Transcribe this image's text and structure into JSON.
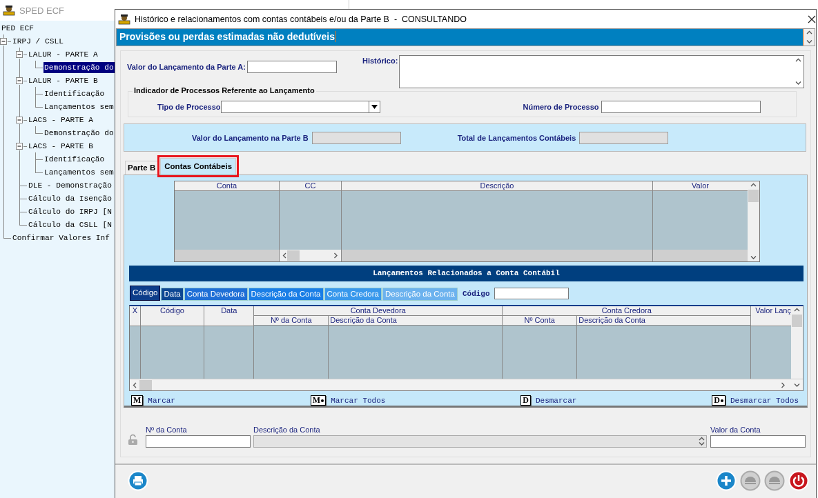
{
  "background_windows": [
    {
      "title": "SPED ECF"
    }
  ],
  "tree": {
    "root": "PED ECF",
    "items": [
      {
        "label": "IRPJ / CSLL",
        "selected": false,
        "expanded": true,
        "children": [
          {
            "label": "LALUR - PARTE A",
            "selected": false,
            "expanded": true,
            "children": [
              {
                "label": "Demonstração do",
                "selected": true
              }
            ]
          },
          {
            "label": "LALUR - PARTE B",
            "selected": false,
            "expanded": true,
            "children": [
              {
                "label": "Identificação",
                "selected": false
              },
              {
                "label": "Lançamentos sem",
                "selected": false
              }
            ]
          },
          {
            "label": "LACS - PARTE A",
            "selected": false,
            "expanded": true,
            "children": [
              {
                "label": "Demonstração do",
                "selected": false
              }
            ]
          },
          {
            "label": "LACS - PARTE B",
            "selected": false,
            "expanded": true,
            "children": [
              {
                "label": "Identificação",
                "selected": false
              },
              {
                "label": "Lançamentos sem",
                "selected": false
              }
            ]
          },
          {
            "label": "DLE - Demonstração",
            "selected": false
          },
          {
            "label": "Cálculo da Isenção",
            "selected": false
          },
          {
            "label": "Cálculo do IRPJ [N",
            "selected": false
          },
          {
            "label": "Cálculo da CSLL [N",
            "selected": false
          }
        ]
      },
      {
        "label": "Confirmar Valores Inf",
        "selected": false
      }
    ]
  },
  "dialog": {
    "title": "Histórico e relacionamentos com contas contábeis e/ou da Parte B  -  CONSULTANDO",
    "header": "Provisões ou perdas estimadas não dedutíveis",
    "valor_parte_a": {
      "label": "Valor do Lançamento da Parte A:"
    },
    "historico": {
      "label": "Histórico:"
    },
    "processos": {
      "legend": "Indicador de Processos Referente ao Lançamento",
      "tipo_label": "Tipo de Processo",
      "numero_label": "Número de Processo"
    },
    "valor_parte_b": {
      "label": "Valor do Lançamento na Parte B",
      "disabled": true
    },
    "total_lancamentos": {
      "label": "Total de Lançamentos Contábeis",
      "disabled": true
    },
    "tabs": [
      {
        "label": "Parte B",
        "selected": false
      },
      {
        "label": "Contas Contábeis",
        "selected": true
      }
    ],
    "contas_grid": {
      "columns": [
        "Conta",
        "CC",
        "Descrição",
        "Valor"
      ]
    },
    "lancamentos_title": "Lançamentos Relacionados a Conta Contábil",
    "sort_tabs": [
      {
        "label": "Código",
        "selected": true,
        "color": "#0d3d8a"
      },
      {
        "label": "Data",
        "selected": false,
        "color": "#0d4793"
      },
      {
        "label": "Conta Devedora",
        "selected": false,
        "color": "#1f6fd6"
      },
      {
        "label": "Descrição da Conta",
        "selected": false,
        "color": "#1a7ee6"
      },
      {
        "label": "Conta Credora",
        "selected": false,
        "color": "#3898ec"
      },
      {
        "label": "Descrição da Conta",
        "selected": false,
        "color": "#6cb2ee"
      }
    ],
    "search_label": "Código",
    "lancamentos_grid": {
      "columns": [
        {
          "kind": "single",
          "label": "X"
        },
        {
          "kind": "single",
          "label": "Código"
        },
        {
          "kind": "single",
          "label": "Data"
        },
        {
          "kind": "group",
          "label": "Conta Devedora",
          "children": [
            "Nº da Conta",
            "Descrição da Conta"
          ]
        },
        {
          "kind": "group",
          "label": "Conta Credora",
          "children": [
            "Nº Conta",
            "Descrição da Conta"
          ]
        },
        {
          "kind": "single",
          "label": "Valor Lanç"
        }
      ]
    },
    "actions": [
      {
        "key": "M",
        "all": false,
        "label": "Marcar"
      },
      {
        "key": "M",
        "all": true,
        "label": "Marcar Todos"
      },
      {
        "key": "D",
        "all": false,
        "label": "Desmarcar"
      },
      {
        "key": "D",
        "all": true,
        "label": "Desmarcar Todos"
      }
    ],
    "entry": {
      "conta_label": "Nº da Conta",
      "descricao_label": "Descrição da Conta",
      "descricao_disabled": true,
      "valor_label": "Valor da Conta"
    },
    "footer_buttons": [
      {
        "kind": "print",
        "disabled": false
      },
      {
        "kind": "add",
        "disabled": false
      },
      {
        "kind": "dome",
        "disabled": true
      },
      {
        "kind": "dome",
        "disabled": true
      },
      {
        "kind": "power",
        "disabled": false
      }
    ]
  }
}
